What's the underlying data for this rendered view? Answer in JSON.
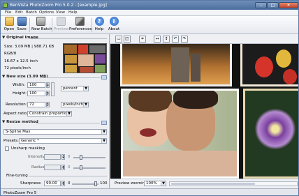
{
  "window": {
    "title": "BenVista PhotoZoom Pro 5.0.2 - [example.jpg]"
  },
  "menu": [
    "File",
    "Edit",
    "Batch",
    "Options",
    "View",
    "Help"
  ],
  "toolbar": {
    "open": "Open",
    "save": "Save",
    "new_batch": "New Batch",
    "preview": "Preview",
    "preferences": "Preferences",
    "help": "Help",
    "about": "About"
  },
  "original": {
    "header": "Original Image",
    "size": "Size: 3.09 MB | 988.71 KB",
    "mode": "RGB/8",
    "dims": "16.67 x 12.5 inch",
    "res": "72 pixels/inch"
  },
  "newsize": {
    "header": "New size (3.09 MB)",
    "width_label": "Width:",
    "width_value": "100",
    "height_label": "Height:",
    "height_value": "100",
    "unit": "percent",
    "res_label": "Resolution:",
    "res_value": "72",
    "res_unit": "pixels/inch",
    "aspect_label": "Aspect ratio:",
    "aspect_value": "Constrain proportions"
  },
  "resize": {
    "header": "Resize method",
    "method": "S-Spline Max",
    "presets_label": "Presets:",
    "presets_value": "Generic *",
    "unsharp_label": "Unsharp masking",
    "intensity_label": "Intensity:",
    "intensity_min": "0",
    "radius_label": "Radius:",
    "radius_min": "0",
    "finetuning_label": "Fine-tuning",
    "sharpness_label": "Sharpness:",
    "sharpness_value": "90.00",
    "sharpness_min": "0",
    "sharpness_max": "100"
  },
  "preview": {
    "zoom_label": "Preview zooming:",
    "zoom_value": "100%"
  },
  "status": {
    "text": "PhotoZoom Pro 5"
  }
}
